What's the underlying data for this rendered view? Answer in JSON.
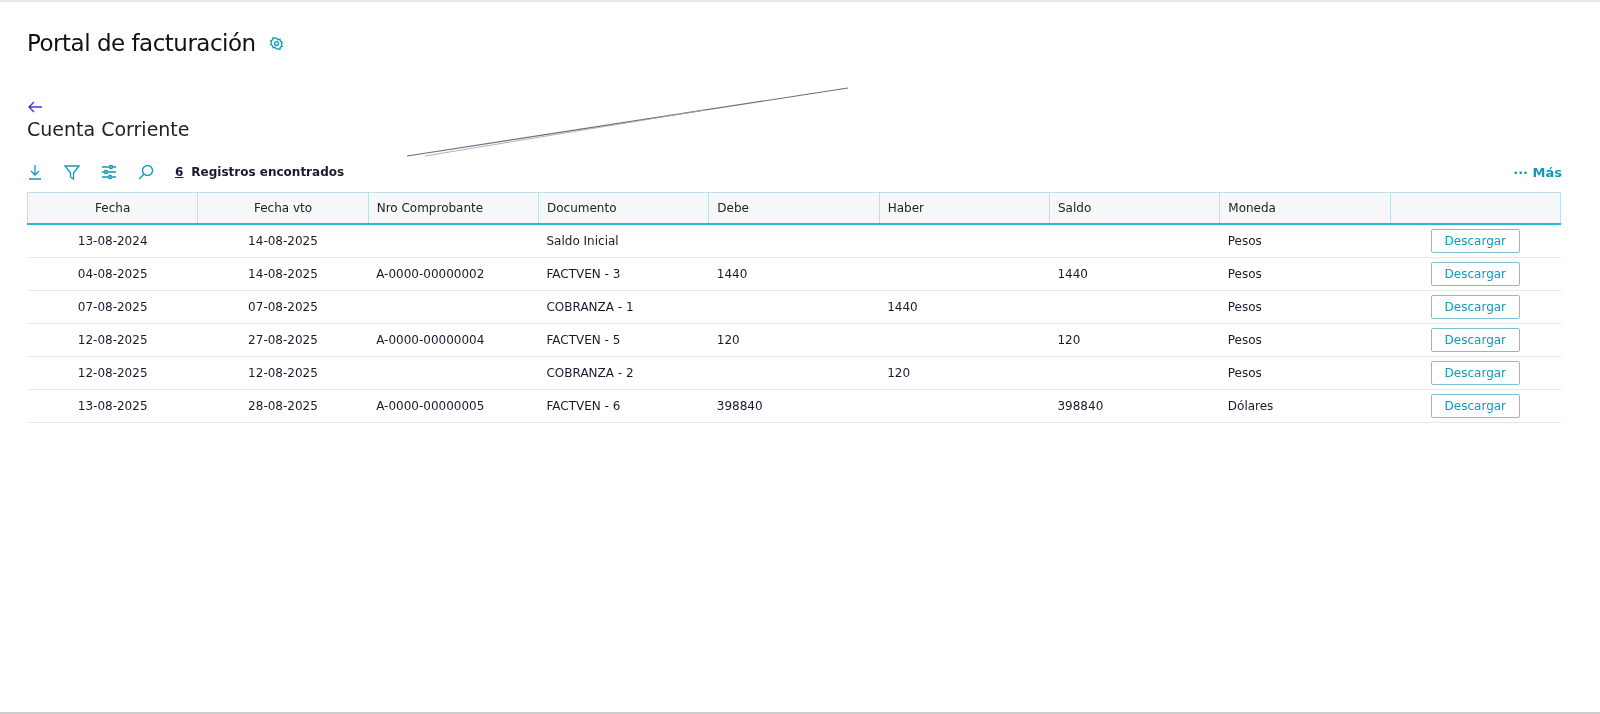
{
  "page": {
    "title": "Portal de facturación"
  },
  "section": {
    "title": "Cuenta Corriente"
  },
  "toolbar": {
    "count": "6",
    "count_label": "Registros encontrados",
    "more": "··· Más"
  },
  "table": {
    "columns": [
      "Fecha",
      "Fecha vto",
      "Nro Comprobante",
      "Documento",
      "Debe",
      "Haber",
      "Saldo",
      "Moneda"
    ],
    "rows": [
      {
        "cells": [
          "13-08-2024",
          "14-08-2025",
          "",
          "Saldo Inicial",
          "",
          "",
          "",
          "Pesos"
        ],
        "action": "Descargar"
      },
      {
        "cells": [
          "04-08-2025",
          "14-08-2025",
          "A-0000-00000002",
          "FACTVEN - 3",
          "1440",
          "",
          "1440",
          "Pesos"
        ],
        "action": "Descargar"
      },
      {
        "cells": [
          "07-08-2025",
          "07-08-2025",
          "",
          "COBRANZA - 1",
          "",
          "1440",
          "",
          "Pesos"
        ],
        "action": "Descargar"
      },
      {
        "cells": [
          "12-08-2025",
          "27-08-2025",
          "A-0000-00000004",
          "FACTVEN - 5",
          "120",
          "",
          "120",
          "Pesos"
        ],
        "action": "Descargar"
      },
      {
        "cells": [
          "12-08-2025",
          "12-08-2025",
          "",
          "COBRANZA - 2",
          "",
          "120",
          "",
          "Pesos"
        ],
        "action": "Descargar"
      },
      {
        "cells": [
          "13-08-2025",
          "28-08-2025",
          "A-0000-00000005",
          "FACTVEN - 6",
          "398840",
          "",
          "398840",
          "Dólares"
        ],
        "action": "Descargar"
      }
    ]
  }
}
